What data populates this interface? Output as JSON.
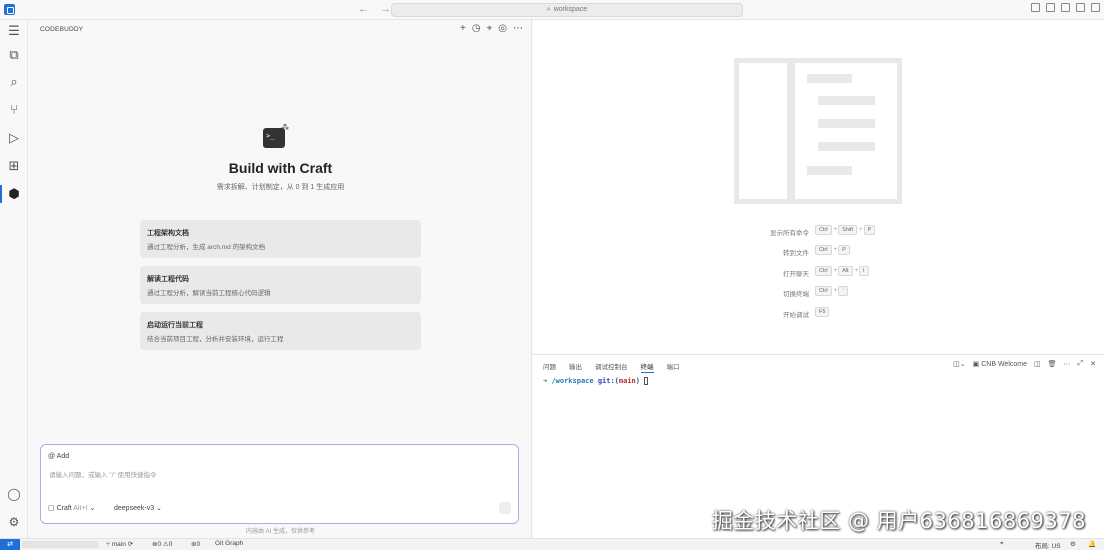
{
  "titlebar": {
    "search_text": "workspace",
    "search_icon": "search-icon",
    "back_icon": "arrow-left-icon",
    "forward_icon": "arrow-right-icon"
  },
  "sidebar_panel": {
    "title": "CODEBUDDY",
    "actions": [
      "plus-icon",
      "history-icon",
      "settings-icon",
      "target-icon",
      "more-icon"
    ]
  },
  "hero": {
    "title": "Build with Craft",
    "subtitle": "需求拆解、计划制定，从 0 到 1 生成应用"
  },
  "cards": [
    {
      "title": "工程架构文档",
      "desc": "通过工程分析，生成 arch.md 的架构文档"
    },
    {
      "title": "解读工程代码",
      "desc": "通过工程分析，解读当前工程核心代码逻辑"
    },
    {
      "title": "启动运行当前工程",
      "desc": "结合当前项目工程，分析并安装环境，运行工程"
    }
  ],
  "chat": {
    "add_label": "Add",
    "placeholder": "请输入问题，或输入 \"/\" 使用快捷指令",
    "mode_label": "Craft",
    "mode_hint": "Alt+I",
    "model_label": "deepseek-v3",
    "footnote": "内容由 AI 生成，仅供参考"
  },
  "shortcuts": [
    {
      "label": "显示所有命令",
      "keys": [
        "Ctrl",
        "Shift",
        "P"
      ]
    },
    {
      "label": "转到文件",
      "keys": [
        "Ctrl",
        "P"
      ]
    },
    {
      "label": "打开聊天",
      "keys": [
        "Ctrl",
        "Alt",
        "I"
      ]
    },
    {
      "label": "切换终端",
      "keys": [
        "Ctrl",
        "`"
      ]
    },
    {
      "label": "开始调试",
      "keys": [
        "F5"
      ]
    }
  ],
  "bottom_panel": {
    "tabs": [
      "问题",
      "输出",
      "调试控制台",
      "终端",
      "端口"
    ],
    "active_tab": "终端",
    "terminal_name": "CNB Welcome",
    "terminal": {
      "arrow": "➜",
      "path": "/workspace",
      "git": "git:",
      "branch_open": "(",
      "branch": "main",
      "branch_close": ")"
    }
  },
  "statusbar": {
    "branch": "main",
    "errors": "0",
    "warnings": "0",
    "ports": "0",
    "git_graph": "Git Graph",
    "layout": "布局: US"
  },
  "watermark": "掘金技术社区 @ 用户636816869378"
}
